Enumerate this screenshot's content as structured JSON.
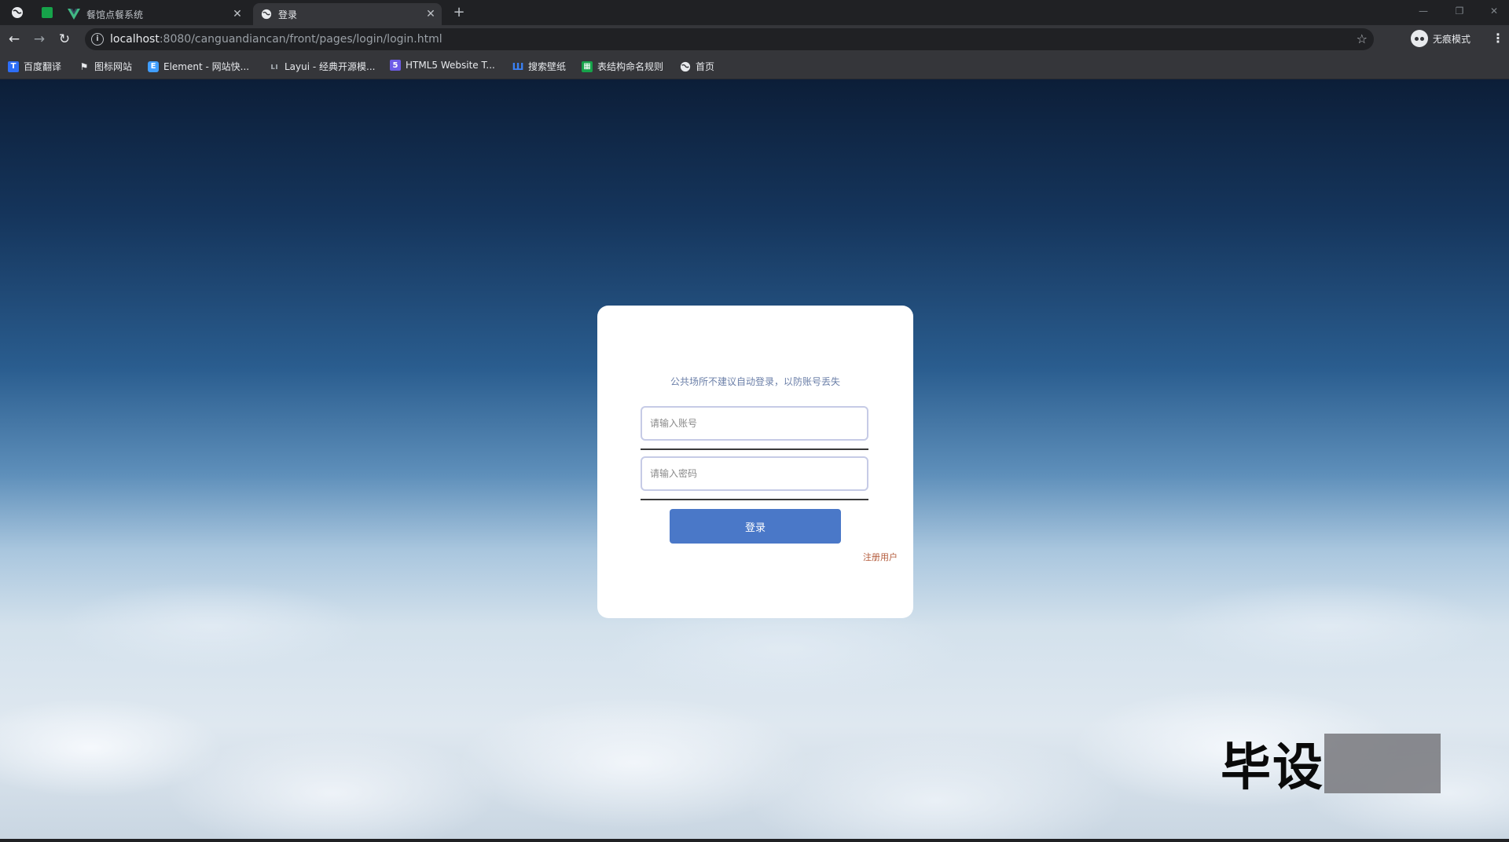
{
  "browser": {
    "tabs": [
      {
        "title": "餐馆点餐系统",
        "active": false
      },
      {
        "title": "登录",
        "active": true
      }
    ],
    "url_host": "localhost",
    "url_path": ":8080/canguandiancan/front/pages/login/login.html",
    "incognito_label": "无痕模式",
    "bookmarks": [
      {
        "label": "百度翻译",
        "icon": "translate-icon",
        "color": "#2d6ef7"
      },
      {
        "label": "图标网站",
        "icon": "flag-icon",
        "color": "#e8eaed"
      },
      {
        "label": "Element - 网站快...",
        "icon": "element-logo-icon",
        "color": "#409eff"
      },
      {
        "label": "Layui - 经典开源模...",
        "icon": "layui-logo-icon",
        "color": "#9aa0a6"
      },
      {
        "label": "HTML5 Website T...",
        "icon": "html5-icon",
        "color": "#6e5ce6"
      },
      {
        "label": "搜索壁纸",
        "icon": "wallpaper-icon",
        "color": "#3b82f6"
      },
      {
        "label": "表结构命名规则",
        "icon": "table-icon",
        "color": "#16a34a"
      },
      {
        "label": "首页",
        "icon": "globe-icon",
        "color": "#e8eaed"
      }
    ]
  },
  "login": {
    "notice": "公共场所不建议自动登录，以防账号丢失",
    "account_placeholder": "请输入账号",
    "password_placeholder": "请输入密码",
    "login_button": "登录",
    "register_link": "注册用户"
  },
  "watermark": {
    "text": "毕设"
  },
  "colors": {
    "primary_button": "#4a78c8",
    "register_link": "#b35a3a",
    "input_border": "#c6cbe6"
  }
}
